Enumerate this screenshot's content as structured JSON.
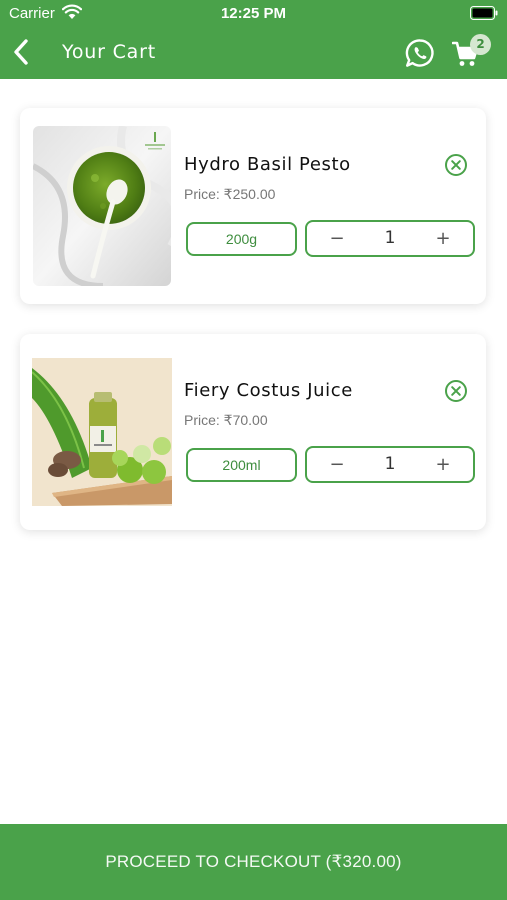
{
  "status_bar": {
    "carrier": "Carrier",
    "time": "12:25 PM"
  },
  "header": {
    "title": "Your Cart",
    "cart_count": "2"
  },
  "cart_items": [
    {
      "name": "Hydro Basil Pesto",
      "price": "Price: ₹250.00",
      "variant": "200g",
      "quantity": "1"
    },
    {
      "name": "Fiery Costus Juice",
      "price": "Price: ₹70.00",
      "variant": "200ml",
      "quantity": "1"
    }
  ],
  "stepper": {
    "minus_symbol": "−",
    "plus_symbol": "+"
  },
  "checkout": {
    "label": "PROCEED TO CHECKOUT (₹320.00)"
  },
  "colors": {
    "primary": "#4aa24a",
    "badge_bg": "#d5e7d0"
  }
}
